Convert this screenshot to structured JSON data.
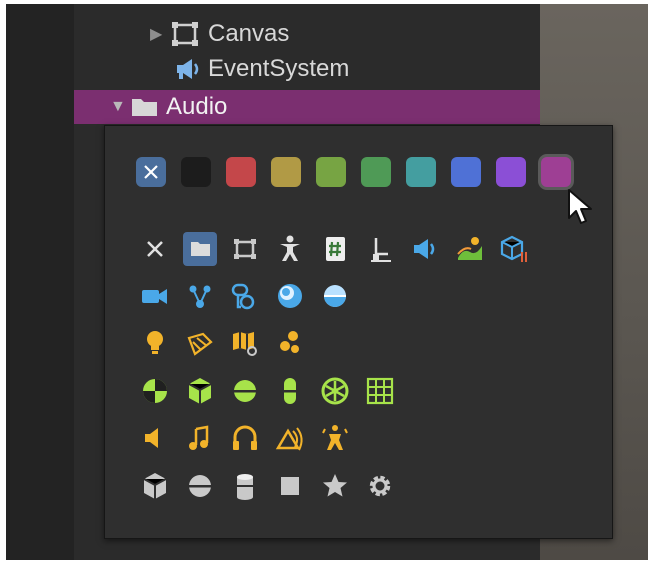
{
  "hierarchy": {
    "items": [
      {
        "label": "Canvas",
        "icon": "canvas-icon"
      },
      {
        "label": "EventSystem",
        "icon": "event-system-icon"
      },
      {
        "label": "Audio",
        "icon": "folder-icon",
        "selected": true
      }
    ]
  },
  "icon_picker": {
    "colors": [
      {
        "name": "none",
        "hex": "#4a6e9c"
      },
      {
        "name": "black",
        "hex": "#1c1c1c"
      },
      {
        "name": "red",
        "hex": "#c4474a"
      },
      {
        "name": "yellow",
        "hex": "#b19a45"
      },
      {
        "name": "green",
        "hex": "#77a443"
      },
      {
        "name": "dark-green",
        "hex": "#4f9a56"
      },
      {
        "name": "teal",
        "hex": "#449ea0"
      },
      {
        "name": "blue",
        "hex": "#4f71d6"
      },
      {
        "name": "purple",
        "hex": "#8b4fd6"
      },
      {
        "name": "magenta",
        "hex": "#9e3f94",
        "selected": true
      }
    ],
    "icon_rows": [
      [
        "clear-icon",
        "folder-icon",
        "rect-transform-icon",
        "humanoid-icon",
        "script-icon",
        "transform-gizmo-icon",
        "event-system-icon",
        "terrain-icon",
        "prefab-variant-icon"
      ],
      [
        "camera-icon",
        "light-probe-icon",
        "reflection-icon",
        "sphere-light-icon",
        "skybox-icon"
      ],
      [
        "bulb-icon",
        "directional-light-icon",
        "light-map-icon",
        "area-light-icon"
      ],
      [
        "physics-material-icon",
        "rigidbody-icon",
        "sphere-collider-icon",
        "capsule-collider-icon",
        "wheel-collider-icon",
        "grid-collider-icon"
      ],
      [
        "audio-source-icon",
        "audio-clip-icon",
        "audio-listener-icon",
        "audio-reverb-icon",
        "audio-chorus-icon"
      ],
      [
        "cube-icon",
        "sphere-icon",
        "cylinder-icon",
        "quad-icon",
        "star-icon",
        "gear-icon"
      ]
    ]
  }
}
